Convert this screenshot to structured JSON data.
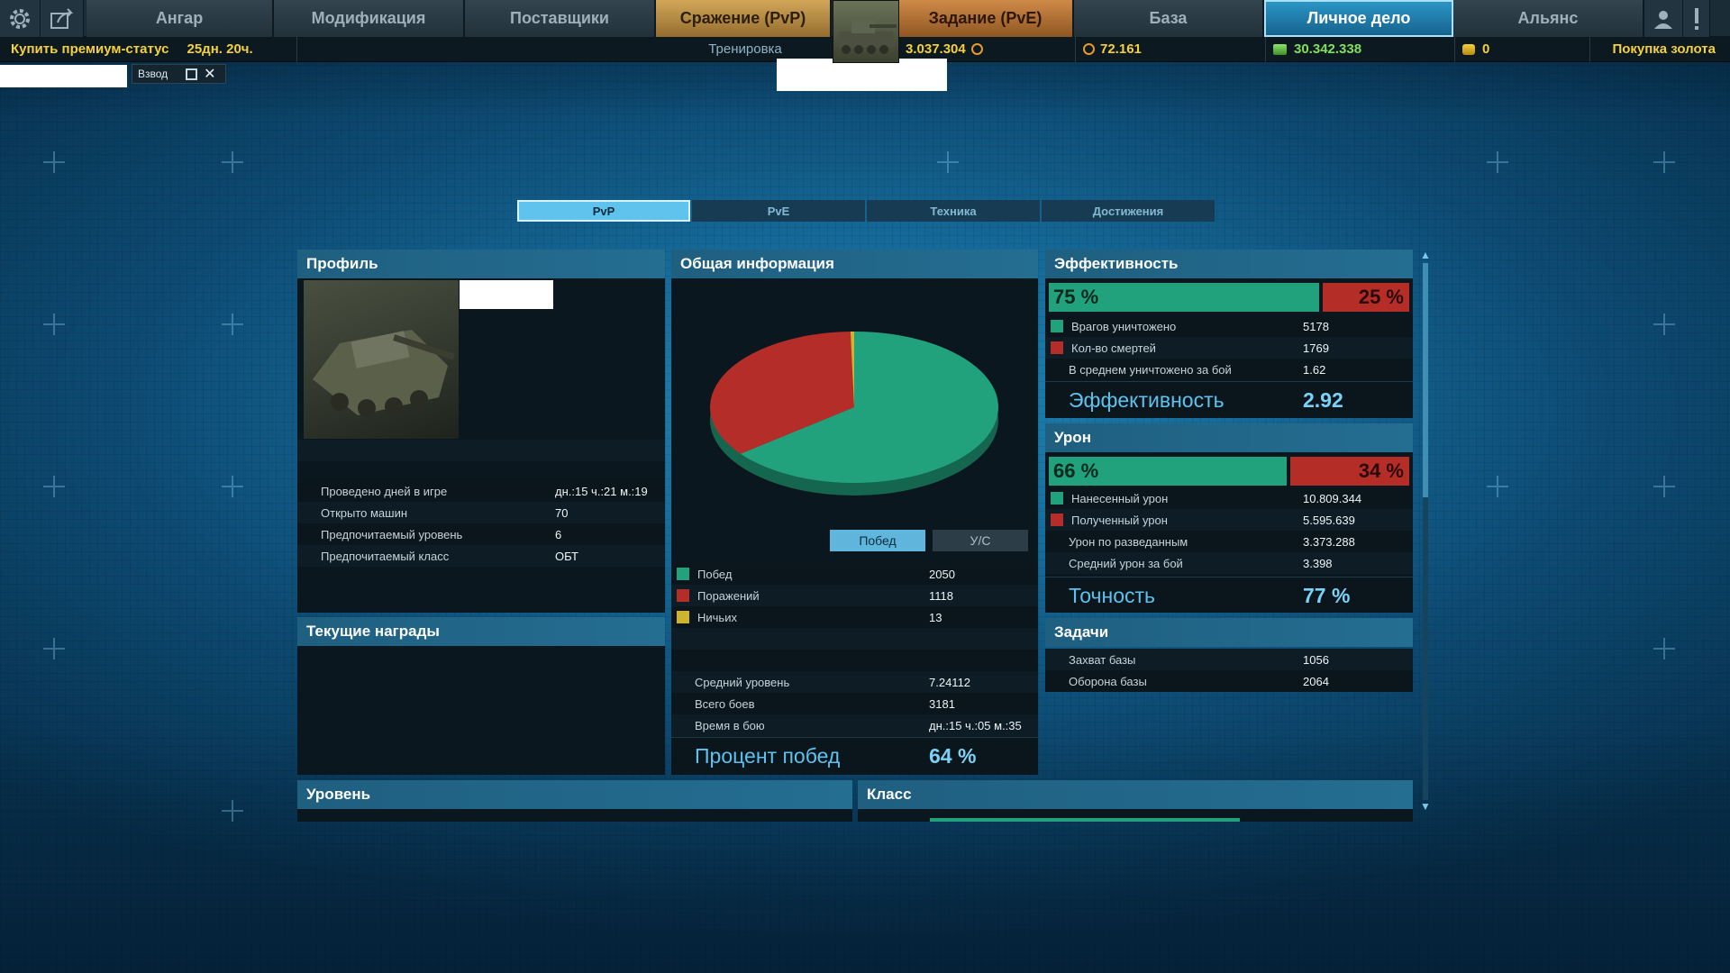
{
  "nav": {
    "tabs": [
      {
        "label": "Ангар"
      },
      {
        "label": "Модификация"
      },
      {
        "label": "Поставщики"
      },
      {
        "label": "Сражение (PvP)"
      },
      {
        "label": "Задание (PvE)"
      },
      {
        "label": "База"
      },
      {
        "label": "Личное дело"
      },
      {
        "label": "Альянс"
      }
    ]
  },
  "status_bar": {
    "premium_label": "Купить премиум-статус",
    "premium_time": "25дн. 20ч.",
    "mode": "Тренировка",
    "currency1": "3.037.304",
    "currency2": "72.161",
    "credits": "30.342.338",
    "gold": "0",
    "buy_gold": "Покупка золота"
  },
  "squad": {
    "label": "Взвод"
  },
  "subtabs": [
    "PvP",
    "PvE",
    "Техника",
    "Достижения"
  ],
  "profile": {
    "title": "Профиль",
    "rows": [
      {
        "label": "Проведено дней в игре",
        "value": "дн.:15 ч.:21 м.:19"
      },
      {
        "label": "Открыто машин",
        "value": "70"
      },
      {
        "label": "Предпочитаемый уровень",
        "value": "6"
      },
      {
        "label": "Предпочитаемый класс",
        "value": "ОБТ"
      }
    ]
  },
  "rewards": {
    "title": "Текущие награды"
  },
  "general": {
    "title": "Общая информация",
    "btn_wins": "Побед",
    "btn_kd": "У/С",
    "legend": [
      {
        "label": "Побед",
        "value": "2050",
        "color": "#22a27c"
      },
      {
        "label": "Поражений",
        "value": "1118",
        "color": "#b42d28"
      },
      {
        "label": "Ничьих",
        "value": "13",
        "color": "#cdb42e"
      }
    ],
    "stats": [
      {
        "label": "Средний уровень",
        "value": "7.24112"
      },
      {
        "label": "Всего боев",
        "value": "3181"
      },
      {
        "label": "Время в бою",
        "value": "дн.:15 ч.:05 м.:35"
      }
    ],
    "win_label": "Процент побед",
    "win_value": "64 %"
  },
  "chart_data": {
    "type": "pie",
    "categories": [
      "Побед",
      "Поражений",
      "Ничьих"
    ],
    "values": [
      2050,
      1118,
      13
    ],
    "colors": [
      "#22a27c",
      "#b42d28",
      "#cdb42e"
    ]
  },
  "efficiency": {
    "title": "Эффективность",
    "pct_good": "75 %",
    "pct_bad": "25 %",
    "good_fraction": 0.75,
    "rows": [
      {
        "label": "Врагов уничтожено",
        "value": "5178",
        "color": "green"
      },
      {
        "label": "Кол-во смертей",
        "value": "1769",
        "color": "red"
      },
      {
        "label": "В среднем уничтожено за бой",
        "value": "1.62",
        "color": ""
      }
    ],
    "big_label": "Эффективность",
    "big_value": "2.92"
  },
  "damage": {
    "title": "Урон",
    "pct_good": "66 %",
    "pct_bad": "34 %",
    "good_fraction": 0.66,
    "rows": [
      {
        "label": "Нанесенный урон",
        "value": "10.809.344",
        "color": "green"
      },
      {
        "label": "Полученный урон",
        "value": "5.595.639",
        "color": "red"
      },
      {
        "label": "Урон по разведанным",
        "value": "3.373.288",
        "color": ""
      },
      {
        "label": "Средний урон за бой",
        "value": "3.398",
        "color": ""
      }
    ],
    "big_label": "Точность",
    "big_value": "77 %"
  },
  "tasks": {
    "title": "Задачи",
    "rows": [
      {
        "label": "Захват базы",
        "value": "1056"
      },
      {
        "label": "Оборона базы",
        "value": "2064"
      }
    ]
  },
  "level": {
    "title": "Уровень"
  },
  "class": {
    "title": "Класс"
  }
}
